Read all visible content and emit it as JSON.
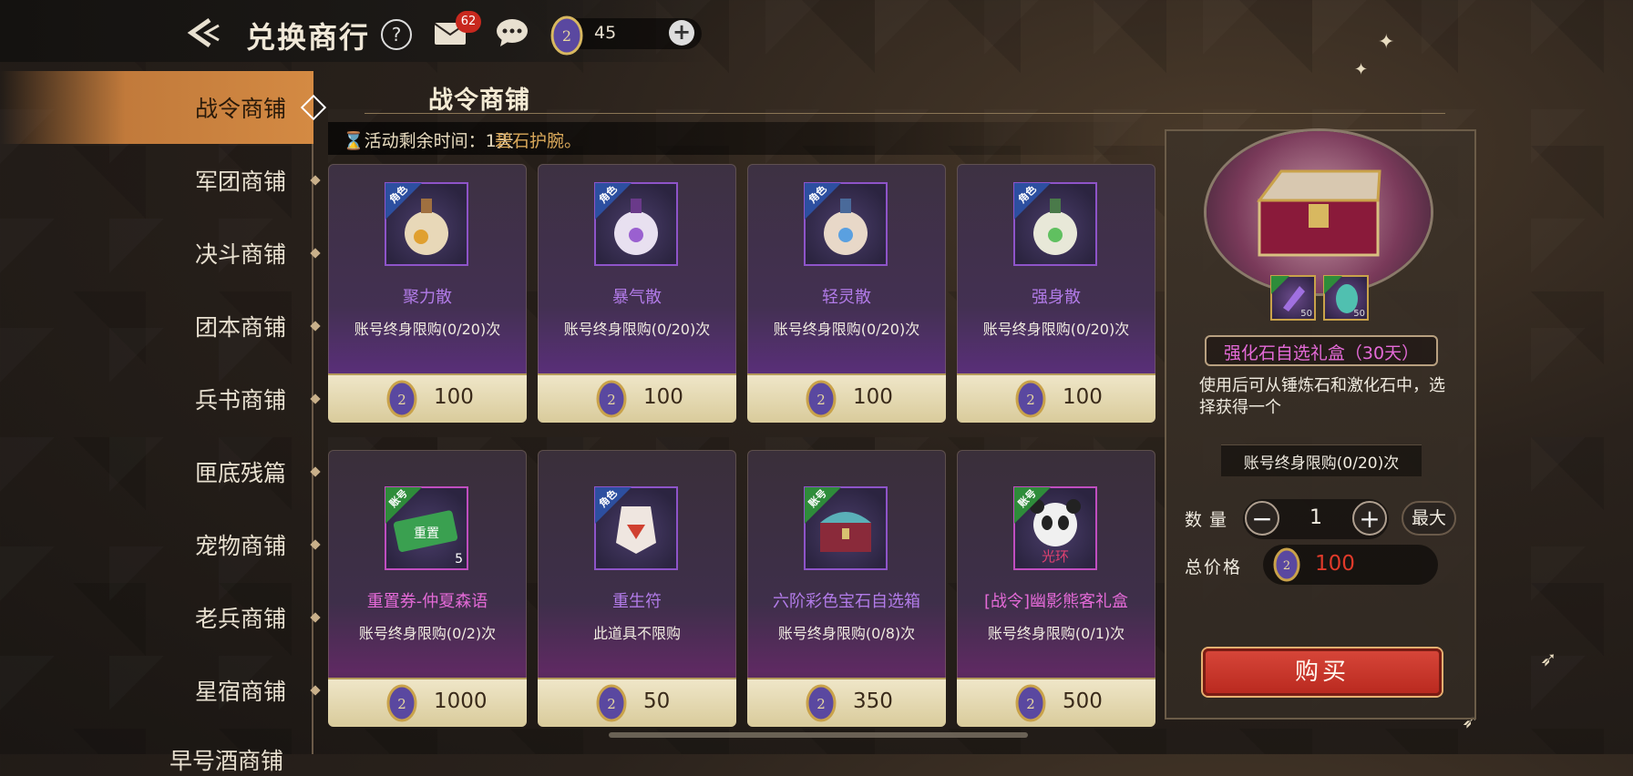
{
  "header": {
    "title": "兑换商行",
    "help_label": "?",
    "mail_badge": "62",
    "currency_amount": "45",
    "currency_plus": "+"
  },
  "tabs": [
    {
      "label": "战令商铺",
      "active": true
    },
    {
      "label": "军团商铺"
    },
    {
      "label": "决斗商铺"
    },
    {
      "label": "团本商铺"
    },
    {
      "label": "兵书商铺"
    },
    {
      "label": "匣底残篇"
    },
    {
      "label": "宠物商铺"
    },
    {
      "label": "老兵商铺"
    },
    {
      "label": "星宿商铺"
    }
  ],
  "section": {
    "title": "战令商铺",
    "timer": "⌛活动剩余时间：1天",
    "scroll_notice": "碧石护腕。"
  },
  "items": [
    {
      "name": "聚力散",
      "limit": "账号终身限购(0/20)次",
      "price": "100",
      "tag": "角色",
      "color": "purple"
    },
    {
      "name": "暴气散",
      "limit": "账号终身限购(0/20)次",
      "price": "100",
      "tag": "角色",
      "color": "purple"
    },
    {
      "name": "轻灵散",
      "limit": "账号终身限购(0/20)次",
      "price": "100",
      "tag": "角色",
      "color": "purple"
    },
    {
      "name": "强身散",
      "limit": "账号终身限购(0/20)次",
      "price": "100",
      "tag": "角色",
      "color": "purple"
    },
    {
      "name": "重置券-仲夏森语",
      "limit": "账号终身限购(0/2)次",
      "price": "1000",
      "tag": "账号",
      "color": "pink",
      "count": "5"
    },
    {
      "name": "重生符",
      "limit": "此道具不限购",
      "price": "50",
      "tag": "角色",
      "color": "purple"
    },
    {
      "name": "六阶彩色宝石自选箱",
      "limit": "账号终身限购(0/8)次",
      "price": "350",
      "tag": "账号",
      "color": "purple"
    },
    {
      "name": "[战令]幽影熊客礼盒",
      "limit": "账号终身限购(0/1)次",
      "price": "500",
      "tag": "账号",
      "color": "pink"
    }
  ],
  "detail": {
    "name": "强化石自选礼盒（30天）",
    "description": "使用后可从锤炼石和激化石中，选择获得一个",
    "limit": "账号终身限购(0/20)次",
    "sub_items": [
      {
        "tag": "账号",
        "count": "50"
      },
      {
        "tag": "账号",
        "count": "50"
      }
    ],
    "qty_label": "数量",
    "quantity": "1",
    "max_label": "最大",
    "total_label": "总价格",
    "total_price": "100",
    "buy_label": "购买"
  },
  "partial_tab": "早号酒商铺",
  "colors": {
    "accent": "#d48a43",
    "buy": "#c8281e",
    "price_red": "#e03a2a"
  }
}
